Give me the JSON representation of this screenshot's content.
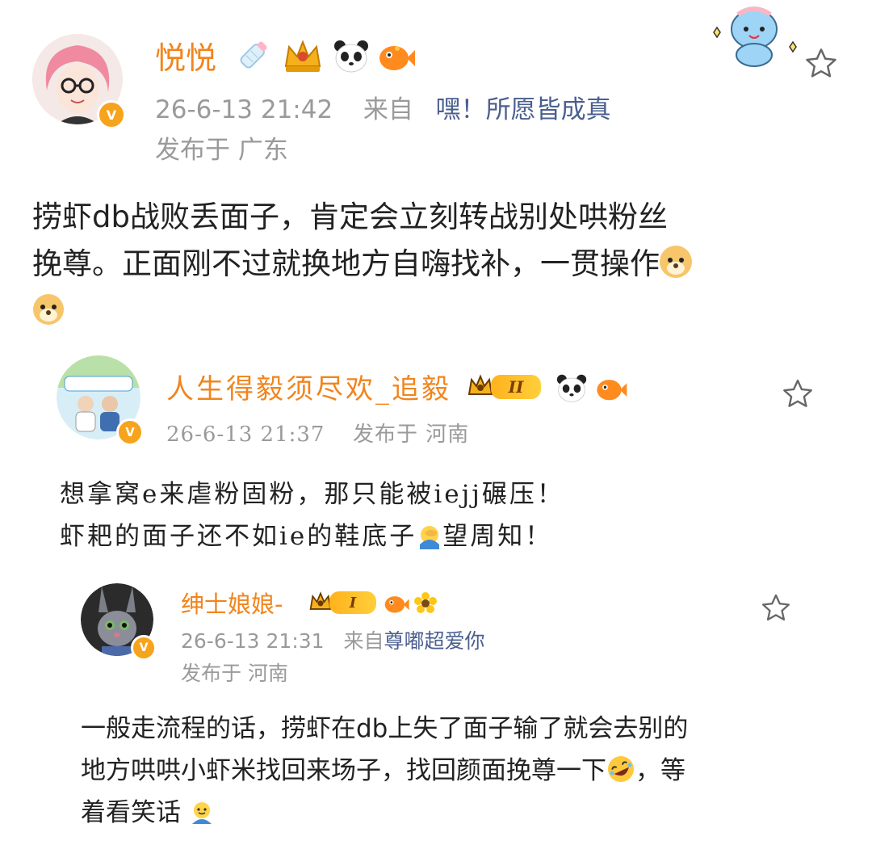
{
  "posts": [
    {
      "username": "悦悦",
      "time": "26-6-13 21:42",
      "source_prefix": "来自",
      "source": "嘿！所愿皆成真",
      "location": "发布于 广东",
      "content_line1": "捞虾db战败丢面子，肯定会立刻转战别处哄粉丝",
      "content_line2": "挽尊。正面刚不过就换地方自嗨找补，一贯操作",
      "badge_level": ""
    },
    {
      "username": "人生得毅须尽欢_追毅",
      "time": "26-6-13 21:37",
      "location": "发布于 河南",
      "badge_level": "II",
      "content_line1": "想拿窝e来虐粉固粉，那只能被iejj碾压！",
      "content_line2_a": "虾耙的面子还不如ie的鞋底子",
      "content_line2_b": "望周知！"
    },
    {
      "username": "绅士娘娘-",
      "time": "26-6-13 21:31",
      "source_prefix": "来自",
      "source": "尊嘟超爱你",
      "location": "发布于 河南",
      "badge_level": "I",
      "content_line1": "一般走流程的话，捞虾在db上失了面子输了就会去别的",
      "content_line2_a": "地方哄哄小虾米找回来场子，找回颜面挽尊一下",
      "content_line2_b": "，等",
      "content_line3": "着看笑话"
    }
  ],
  "verified_mark": "V",
  "icons": {
    "favorite": "star-outline-icon",
    "bottle": "baby-bottle-icon",
    "crown": "gold-crown-icon",
    "panda": "panda-icon",
    "fish": "orange-fish-icon",
    "doge": "doge-emoji-icon",
    "laugh": "rolling-laugh-emoji-icon",
    "facepalm": "facepalm-emoji-icon",
    "hug": "hug-emoji-icon",
    "sunflower": "sunflower-icon",
    "mascot": "blue-mascot-decoration-icon"
  },
  "colors": {
    "username": "#f2841c",
    "meta": "#9a9a9a",
    "source_link": "#4b5f8f",
    "text": "#222222",
    "verified": "#f7a31b"
  }
}
